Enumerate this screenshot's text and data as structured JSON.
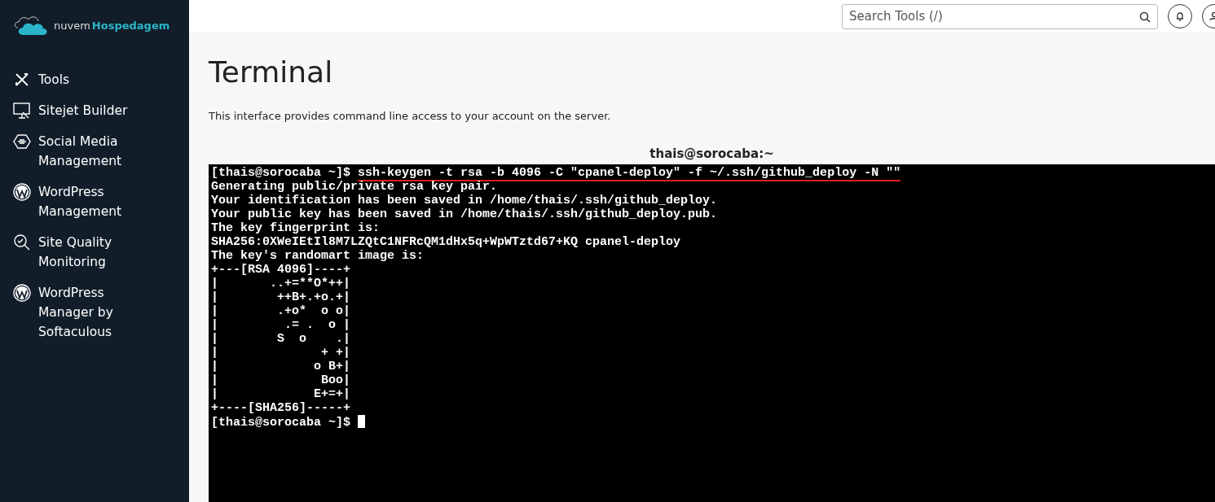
{
  "logo": {
    "prefix": "nuvem",
    "name": "Hospedagem"
  },
  "sidebar": {
    "items": [
      {
        "label": "Tools",
        "kind": "tools"
      },
      {
        "label": "Sitejet Builder",
        "kind": "monitor"
      },
      {
        "label": "Social Media Management",
        "kind": "social"
      },
      {
        "label": "WordPress Management",
        "kind": "wp"
      },
      {
        "label": "Site Quality Monitoring",
        "kind": "quality"
      },
      {
        "label": "WordPress Manager by Softaculous",
        "kind": "wp"
      }
    ]
  },
  "search": {
    "placeholder": "Search Tools (/)"
  },
  "page": {
    "title": "Terminal",
    "description": "This interface provides command line access to your account on the server."
  },
  "terminal": {
    "title": "thais@sorocaba:~",
    "prompt": "[thais@sorocaba ~]$ ",
    "command": "ssh-keygen -t rsa -b 4096 -C \"cpanel-deploy\" -f ~/.ssh/github_deploy -N \"\"",
    "output": [
      "Generating public/private rsa key pair.",
      "Your identification has been saved in /home/thais/.ssh/github_deploy.",
      "Your public key has been saved in /home/thais/.ssh/github_deploy.pub.",
      "The key fingerprint is:",
      "SHA256:0XWeIEtIl8M7LZQtC1NFRcQM1dHx5q+WpWTztd67+KQ cpanel-deploy",
      "The key's randomart image is:",
      "+---[RSA 4096]----+",
      "|       ..+=**O*++|",
      "|        ++B+.+o.+|",
      "|        .+o*  o o|",
      "|         .= .  o |",
      "|        S  o    .|",
      "|              + +|",
      "|             o B+|",
      "|              Boo|",
      "|             E+=+|",
      "+----[SHA256]-----+"
    ],
    "last_prompt": "[thais@sorocaba ~]$ "
  }
}
